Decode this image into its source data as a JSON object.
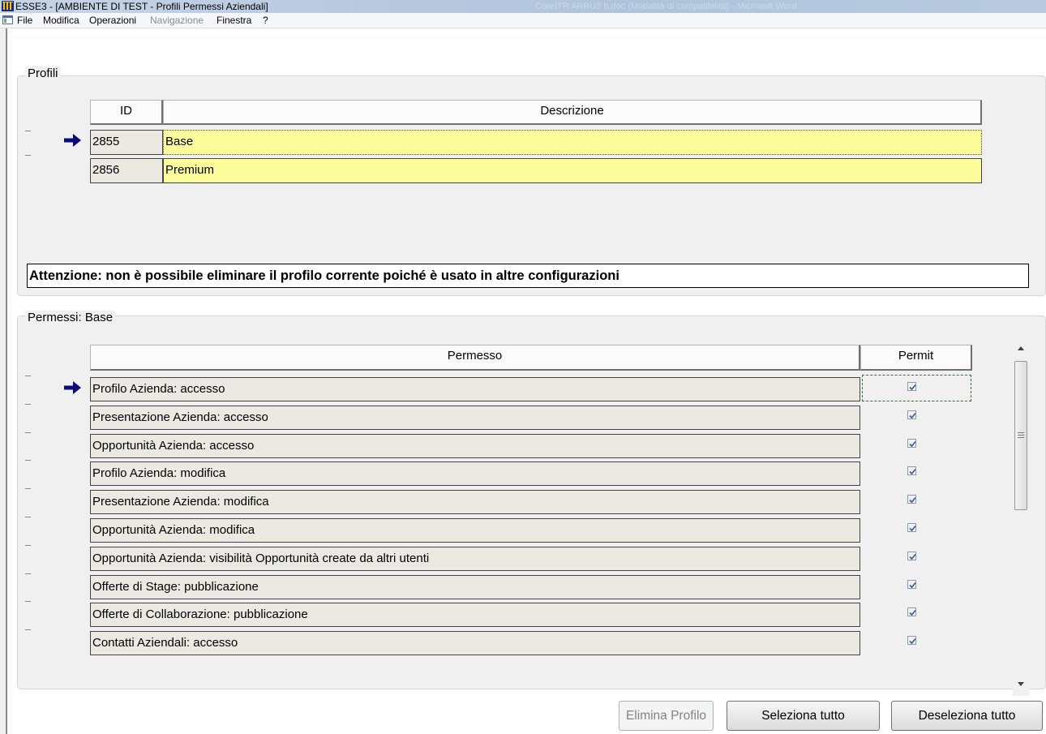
{
  "window": {
    "title": "ESSE3 - [AMBIENTE DI TEST - Profili Permessi Aziendali]",
    "background_window_title": "CoreITR ARRU2 b.doc (Modalità di compatibilità) - Microsoft Word"
  },
  "menu": [
    {
      "label": "File",
      "enabled": true
    },
    {
      "label": "Modifica",
      "enabled": true
    },
    {
      "label": "Operazioni",
      "enabled": true
    },
    {
      "label": "Navigazione",
      "enabled": false
    },
    {
      "label": "Finestra",
      "enabled": true
    },
    {
      "label": "?",
      "enabled": true
    }
  ],
  "profili": {
    "group_label": "Profili",
    "columns": {
      "id": "ID",
      "descrizione": "Descrizione"
    },
    "rows": [
      {
        "id": "2855",
        "descrizione": "Base",
        "current": true
      },
      {
        "id": "2856",
        "descrizione": "Premium",
        "current": false
      }
    ],
    "warning": "Attenzione: non è possibile eliminare il profilo corrente poiché è usato in altre configurazioni"
  },
  "permessi": {
    "group_label": "Permessi: Base",
    "columns": {
      "permesso": "Permesso",
      "permit": "Permit"
    },
    "rows": [
      {
        "permesso": "Profilo Azienda: accesso",
        "permit": true,
        "current": true
      },
      {
        "permesso": "Presentazione Azienda: accesso",
        "permit": true
      },
      {
        "permesso": "Opportunità Azienda: accesso",
        "permit": true
      },
      {
        "permesso": "Profilo Azienda: modifica",
        "permit": true
      },
      {
        "permesso": "Presentazione Azienda: modifica",
        "permit": true
      },
      {
        "permesso": "Opportunità Azienda: modifica",
        "permit": true
      },
      {
        "permesso": "Opportunità Azienda: visibilità Opportunità create da altri utenti",
        "permit": true
      },
      {
        "permesso": "Offerte di Stage: pubblicazione",
        "permit": true
      },
      {
        "permesso": "Offerte di Collaborazione: pubblicazione",
        "permit": true
      },
      {
        "permesso": "Contatti Aziendali: accesso",
        "permit": true
      }
    ]
  },
  "buttons": {
    "elimina": {
      "label": "Elimina Profilo",
      "enabled": false
    },
    "seleziona": {
      "label": "Seleziona tutto",
      "enabled": true
    },
    "deseleziona": {
      "label": "Deseleziona tutto",
      "enabled": true
    }
  },
  "colors": {
    "description_highlight": "#fcfc9a",
    "cell_background": "#ece9e3",
    "arrow": "#0b0b7e"
  }
}
